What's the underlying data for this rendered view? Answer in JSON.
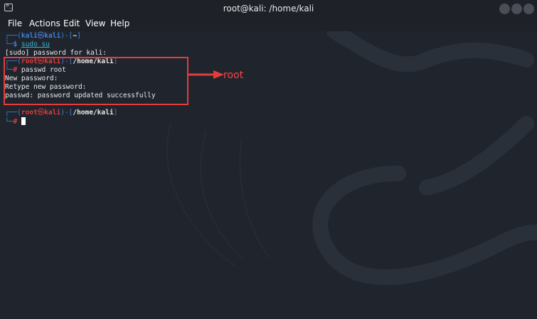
{
  "window": {
    "title": "root@kali: /home/kali"
  },
  "menu": {
    "items": [
      "File",
      "Actions",
      "Edit",
      "View",
      "Help"
    ]
  },
  "terminal": {
    "block1": {
      "prompt_open": "┌──(",
      "user": "kali",
      "skull": "㉿",
      "host": "kali",
      "prompt_mid": ")-[",
      "dir": "~",
      "prompt_close": "]",
      "prompt_second": "└─",
      "symbol": "$",
      "command": "sudo su",
      "output": "[sudo] password for kali:"
    },
    "block2": {
      "prompt_open": "┌──(",
      "user": "root",
      "skull": "㉿",
      "host": "kali",
      "prompt_mid": ")-[",
      "dir": "/home/kali",
      "prompt_close": "]",
      "prompt_second": "└─",
      "symbol": "#",
      "command": "passwd root",
      "output1": "New password:",
      "output2": "Retype new password:",
      "output3": "passwd: password updated successfully"
    },
    "block3": {
      "prompt_open": "┌──(",
      "user": "root",
      "skull": "㉿",
      "host": "kali",
      "prompt_mid": ")-[",
      "dir": "/home/kali",
      "prompt_close": "]",
      "prompt_second": "└─",
      "symbol": "#"
    }
  },
  "annotation": {
    "text": "root",
    "color": "#ff4343"
  }
}
